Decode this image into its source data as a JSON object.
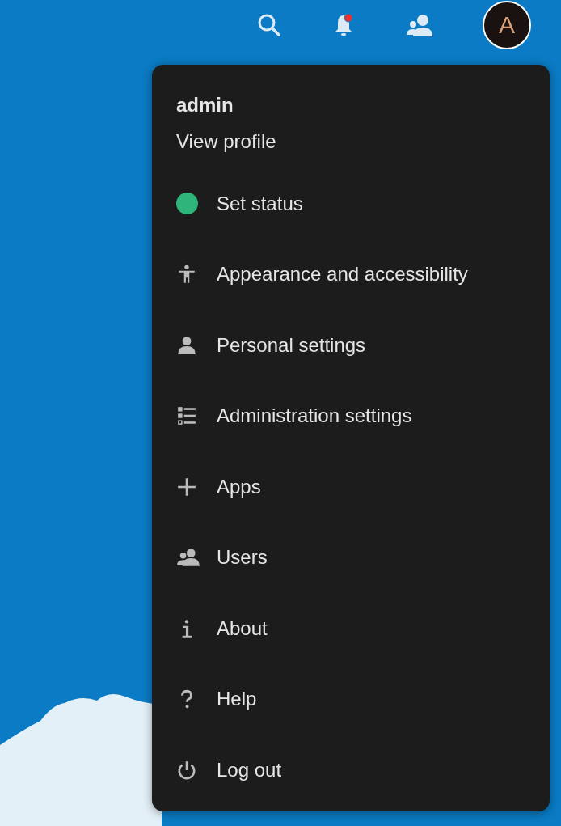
{
  "header": {
    "notifications": {
      "unread": true
    },
    "avatar": {
      "initial": "A"
    }
  },
  "menu": {
    "user": "admin",
    "profile_link": "View profile",
    "items": [
      {
        "kind": "status",
        "label": "Set status",
        "color": "#2fb47c"
      },
      {
        "kind": "accessibility",
        "label": "Appearance and accessibility"
      },
      {
        "kind": "person",
        "label": "Personal settings"
      },
      {
        "kind": "admin",
        "label": "Administration settings"
      },
      {
        "kind": "plus",
        "label": "Apps"
      },
      {
        "kind": "users",
        "label": "Users"
      },
      {
        "kind": "info",
        "label": "About"
      },
      {
        "kind": "help",
        "label": "Help"
      },
      {
        "kind": "logout",
        "label": "Log out"
      }
    ]
  }
}
